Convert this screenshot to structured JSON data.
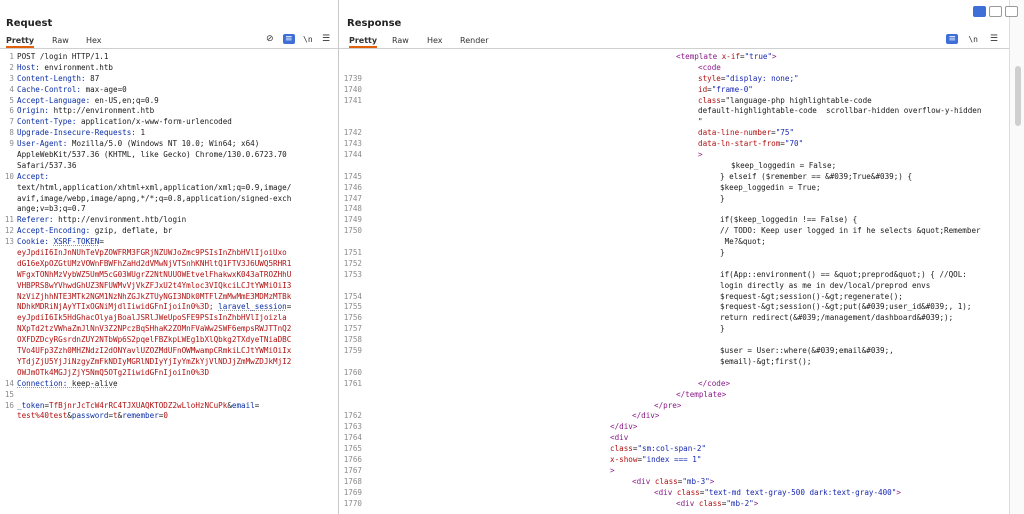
{
  "request": {
    "title": "Request",
    "tabs": [
      "Pretty",
      "Raw",
      "Hex"
    ],
    "lines": [
      {
        "n": "1",
        "text": "POST /login HTTP/1.1",
        "type": "plain"
      },
      {
        "n": "2",
        "text": "Host: environment.htb",
        "type": "header",
        "key": "Host",
        "value": " environment.htb"
      },
      {
        "n": "3",
        "text": "Content-Length: 87",
        "type": "header",
        "key": "Content-Length",
        "value": " 87"
      },
      {
        "n": "4",
        "text": "Cache-Control: max-age=0",
        "type": "header",
        "key": "Cache-Control",
        "value": " max-age=0"
      },
      {
        "n": "5",
        "text": "Accept-Language: en-US,en;q=0.9",
        "type": "header",
        "key": "Accept-Language",
        "value": " en-US,en;q=0.9"
      },
      {
        "n": "6",
        "text": "Origin: http://environment.htb",
        "type": "header",
        "key": "Origin",
        "value": " http://environment.htb"
      },
      {
        "n": "7",
        "text": "Content-Type: application/x-www-form-urlencoded",
        "type": "header",
        "key": "Content-Type",
        "value": " application/x-www-form-urlencoded"
      },
      {
        "n": "8",
        "text": "Upgrade-Insecure-Requests: 1",
        "type": "header",
        "key": "Upgrade-Insecure-Requests",
        "value": " 1"
      },
      {
        "n": "9",
        "text": "User-Agent: Mozilla/5.0 (Windows NT 10.0; Win64; x64)",
        "type": "header",
        "key": "User-Agent",
        "value": " Mozilla/5.0 (Windows NT 10.0; Win64; x64)"
      },
      {
        "n": "",
        "text": "AppleWebKit/537.36 (KHTML, like Gecko) Chrome/130.0.6723.70",
        "type": "plain"
      },
      {
        "n": "",
        "text": "Safari/537.36",
        "type": "plain"
      },
      {
        "n": "10",
        "text": "Accept:",
        "type": "header",
        "key": "Accept",
        "value": ""
      },
      {
        "n": "",
        "text": "text/html,application/xhtml+xml,application/xml;q=0.9,image/",
        "type": "plain"
      },
      {
        "n": "",
        "text": "avif,image/webp,image/apng,*/*;q=0.8,application/signed-exch",
        "type": "plain"
      },
      {
        "n": "",
        "text": "ange;v=b3;q=0.7",
        "type": "plain"
      },
      {
        "n": "11",
        "text": "Referer: http://environment.htb/login",
        "type": "header",
        "key": "Referer",
        "value": " http://environment.htb/login"
      },
      {
        "n": "12",
        "text": "Accept-Encoding: gzip, deflate, br",
        "type": "header",
        "key": "Accept-Encoding",
        "value": " gzip, deflate, br"
      },
      {
        "n": "13",
        "text": "Cookie: XSRF-TOKEN=",
        "type": "cookie"
      },
      {
        "n": "",
        "text": "eyJpdiI6InJnNUhTeVpZOWFRM3FGRjNZUWJoZmc9PSIsInZhbHVlIjoiUxo",
        "type": "red"
      },
      {
        "n": "",
        "text": "dG16eXpOZGtUMzVOWnFBWFhZaHd2dVMwNjVTSnhKNHltQ1FTV3J6UWQ5RHR1",
        "type": "red"
      },
      {
        "n": "",
        "text": "WFgxTONhMzVybWZ5UmM5cG03WUgrZ2NtNUUOWEtvelFhakwxK043aTROZHhU",
        "type": "red"
      },
      {
        "n": "",
        "text": "VHBPRS8wYVhwdGhUZ3NFUWMvVjVkZFJxU2t4Ymloc3VIQkciLCJtYWMiOiI3",
        "type": "red"
      },
      {
        "n": "",
        "text": "NzViZjhhNTE3MTk2NGM1NzNhZGJkZTUyNGI3NDk0MTFlZmMwMmE3MDMzMTBk",
        "type": "red"
      },
      {
        "n": "",
        "text": "NDhkMDRiNjAyYTIxOGNiMjdlIiwidGFnIjoiIn0%3D; laravel_session=",
        "type": "redsession"
      },
      {
        "n": "",
        "text": "eyJpdiI6Ik5HdGhacOlyajBoalJSRlJWeUpoSFE9PSIsInZhbHVlIjoizla",
        "type": "red"
      },
      {
        "n": "",
        "text": "NXpTd2tzVWhaZmJlNnV3Z2NPczBqSHhaK2ZOMnFVaWw2SWF6empsRWJTTnQ2",
        "type": "red"
      },
      {
        "n": "",
        "text": "OXFDZDcyRGsrdnZUY2NTbWp6S2pqelFBZkpLWEg1bXlQbkg2TXdyeTNiaDBC",
        "type": "red"
      },
      {
        "n": "",
        "text": "TVo4UFp3Zzh0MHZNdzI2dONYavlUZOZMdUFnOWMwampCRmkiLCJtYWMiOiIx",
        "type": "red"
      },
      {
        "n": "",
        "text": "YTdjZjU5YjJiNzgyZmFkNDIyMGRlNDIyYjIyYmZkYjVlNDJjZmMwZDJkMjI2",
        "type": "red"
      },
      {
        "n": "",
        "text": "OWJmOTk4MGJjZjY5NmQ5OTg2IiwidGFnIjoiIn0%3D",
        "type": "red"
      },
      {
        "n": "14",
        "text": "Connection: keep-alive",
        "type": "conn"
      },
      {
        "n": "15",
        "text": "",
        "type": "plain"
      },
      {
        "n": "16",
        "text": "_token=TfBjnrJcTcW4rRC4TJXUAQKTODZ2wLloHzNCuPk&email=",
        "type": "body1"
      },
      {
        "n": "",
        "text": "test%40test&password=t&remember=0",
        "type": "body2"
      }
    ]
  },
  "response": {
    "title": "Response",
    "tabs": [
      "Pretty",
      "Raw",
      "Hex",
      "Render"
    ],
    "lines": [
      {
        "n": "",
        "i": 56,
        "text": "<template x-if=\"true\">"
      },
      {
        "n": "",
        "i": 60,
        "text": "<code"
      },
      {
        "n": "1739",
        "i": 60,
        "text": "style=\"display: none;\""
      },
      {
        "n": "1740",
        "i": 60,
        "text": "id=\"frame-0\""
      },
      {
        "n": "1741",
        "i": 60,
        "text": "class=\"language-php highlightable-code"
      },
      {
        "n": "",
        "i": 60,
        "text": "default-highlightable-code  scrollbar-hidden overflow-y-hidden"
      },
      {
        "n": "",
        "i": 60,
        "text": "\""
      },
      {
        "n": "1742",
        "i": 60,
        "text": "data-line-number=\"75\""
      },
      {
        "n": "1743",
        "i": 60,
        "text": "data-ln-start-from=\"70\""
      },
      {
        "n": "1744",
        "i": 60,
        "text": ">"
      },
      {
        "n": "",
        "i": 66,
        "text": "$keep_loggedin = False;"
      },
      {
        "n": "1745",
        "i": 64,
        "text": "} elseif ($remember == &#039;True&#039;) {"
      },
      {
        "n": "1746",
        "i": 64,
        "text": "$keep_loggedin = True;"
      },
      {
        "n": "1747",
        "i": 64,
        "text": "}"
      },
      {
        "n": "1748",
        "i": 0,
        "text": ""
      },
      {
        "n": "1749",
        "i": 64,
        "text": "if($keep_loggedin !== False) {"
      },
      {
        "n": "1750",
        "i": 64,
        "text": "// TODO: Keep user logged in if he selects &quot;Remember"
      },
      {
        "n": "",
        "i": 64,
        "text": " Me?&quot;"
      },
      {
        "n": "1751",
        "i": 64,
        "text": "}"
      },
      {
        "n": "1752",
        "i": 0,
        "text": ""
      },
      {
        "n": "1753",
        "i": 64,
        "text": "if(App::environment() == &quot;preprod&quot;) { //QOL:"
      },
      {
        "n": "",
        "i": 64,
        "text": "login directly as me in dev/local/preprod envs"
      },
      {
        "n": "1754",
        "i": 64,
        "text": "$request-&gt;session()-&gt;regenerate();"
      },
      {
        "n": "1755",
        "i": 64,
        "text": "$request-&gt;session()-&gt;put(&#039;user_id&#039;, 1);"
      },
      {
        "n": "1756",
        "i": 64,
        "text": "return redirect(&#039;/management/dashboard&#039;);"
      },
      {
        "n": "1757",
        "i": 64,
        "text": "}"
      },
      {
        "n": "1758",
        "i": 0,
        "text": ""
      },
      {
        "n": "1759",
        "i": 64,
        "text": "$user = User::where(&#039;email&#039;,"
      },
      {
        "n": "",
        "i": 64,
        "text": "$email)-&gt;first();"
      },
      {
        "n": "1760",
        "i": 0,
        "text": ""
      },
      {
        "n": "1761",
        "i": 60,
        "text": "</code>"
      },
      {
        "n": "",
        "i": 56,
        "text": "</template>"
      },
      {
        "n": "",
        "i": 52,
        "text": "</pre>"
      },
      {
        "n": "1762",
        "i": 48,
        "text": "</div>"
      },
      {
        "n": "1763",
        "i": 44,
        "text": "</div>"
      },
      {
        "n": "1764",
        "i": 44,
        "text": "<div"
      },
      {
        "n": "1765",
        "i": 44,
        "text": "class=\"sm:col-span-2\""
      },
      {
        "n": "1766",
        "i": 44,
        "text": "x-show=\"index === 1\""
      },
      {
        "n": "1767",
        "i": 44,
        "text": ">"
      },
      {
        "n": "1768",
        "i": 48,
        "text": "<div class=\"mb-3\">"
      },
      {
        "n": "1769",
        "i": 52,
        "text": "<div class=\"text-md text-gray-500 dark:text-gray-400\">"
      },
      {
        "n": "1770",
        "i": 56,
        "text": "<div class=\"mb-2\">"
      }
    ]
  },
  "icons": {
    "hide": "eye-slash-icon",
    "wrap": "wrap-lines-icon",
    "newline": "newline-icon",
    "menu": "hamburger-menu-icon",
    "layout_split": "split-view-icon",
    "layout_h": "horizontal-view-icon",
    "layout_v": "vertical-view-icon"
  },
  "newline_label": "\\n"
}
